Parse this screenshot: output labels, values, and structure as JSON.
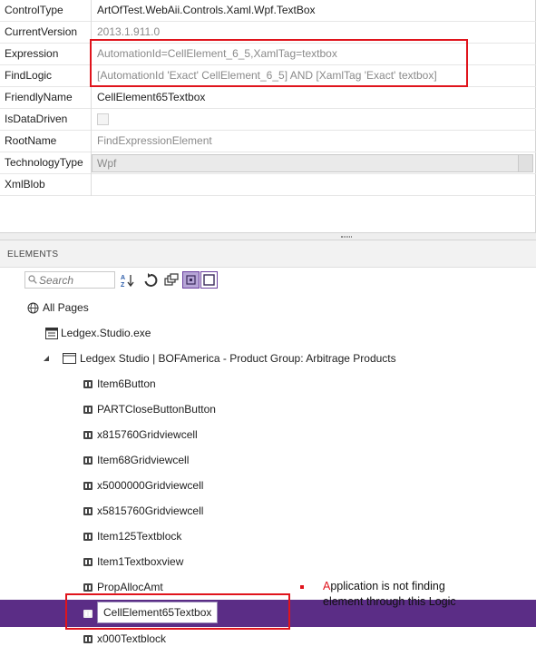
{
  "properties": [
    {
      "name": "ControlType",
      "value": "ArtOfTest.WebAii.Controls.Xaml.Wpf.TextBox",
      "style": "dark"
    },
    {
      "name": "CurrentVersion",
      "value": "2013.1.911.0",
      "style": "gray"
    },
    {
      "name": "Expression",
      "value": "AutomationId=CellElement_6_5,XamlTag=textbox",
      "style": "gray"
    },
    {
      "name": "FindLogic",
      "value": "[AutomationId 'Exact' CellElement_6_5] AND [XamlTag 'Exact' textbox]",
      "style": "gray"
    },
    {
      "name": "FriendlyName",
      "value": "CellElement65Textbox",
      "style": "dark"
    },
    {
      "name": "IsDataDriven",
      "value": "",
      "style": "checkbox"
    },
    {
      "name": "RootName",
      "value": "FindExpressionElement",
      "style": "gray"
    },
    {
      "name": "TechnologyType",
      "value": "Wpf",
      "style": "select"
    },
    {
      "name": "XmlBlob",
      "value": "",
      "style": "dark"
    }
  ],
  "elements_panel": {
    "header": "ELEMENTS",
    "search_placeholder": "Search"
  },
  "tree": {
    "root": "All Pages",
    "app": "Ledgex.Studio.exe",
    "window": "Ledgex Studio | BOFAmerica - Product Group: Arbitrage Products",
    "children": [
      "Item6Button",
      "PARTCloseButtonButton",
      "x815760Gridviewcell",
      "Item68Gridviewcell",
      "x5000000Gridviewcell",
      "x5815760Gridviewcell",
      "Item125Textblock",
      "Item1Textboxview",
      "PropAllocAmt",
      "CellElement65Textbox",
      "x000Textblock"
    ],
    "selected": "CellElement65Textbox"
  },
  "annotation": {
    "first_letter": "A",
    "rest": "pplication is not finding element through this Logic"
  },
  "colors": {
    "highlight": "#e0141c",
    "selection": "#5b2d86"
  }
}
